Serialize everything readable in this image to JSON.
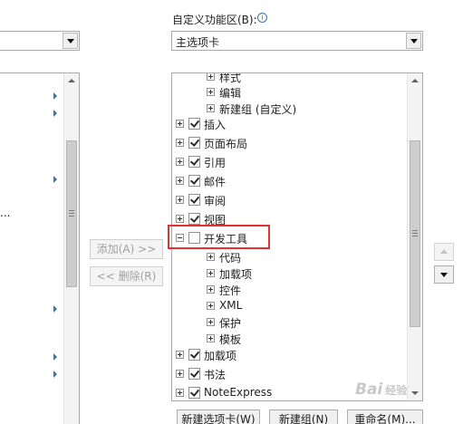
{
  "right_panel": {
    "label": "自定义功能区(B):",
    "info_icon": "info-icon",
    "selected_dropdown": "主选项卡"
  },
  "middle_buttons": {
    "add": "添加(A) >>",
    "remove": "<< 删除(R)"
  },
  "tree": {
    "top_partial": "样式",
    "sub_items_top": [
      "编辑",
      "新建组 (自定义)"
    ],
    "tabs_checked": [
      "插入",
      "页面布局",
      "引用",
      "邮件",
      "审阅",
      "视图"
    ],
    "developer": {
      "label": "开发工具",
      "checked": false,
      "children": [
        "代码",
        "加载项",
        "控件",
        "XML",
        "保护",
        "模板"
      ]
    },
    "tabs_after": [
      "加载项",
      "书法",
      "NoteExpress"
    ]
  },
  "bottom_buttons": {
    "new_tab": "新建选项卡(W)",
    "new_group": "新建组(N)",
    "rename": "重命名(M)..."
  },
  "left_panel": {
    "truncated_text": "..."
  },
  "watermark": {
    "text": "Bai",
    "suffix": "经验"
  },
  "colors": {
    "highlight": "#e8312e",
    "border": "#a9a9a9",
    "arrow_blue": "#3a6fb5"
  }
}
